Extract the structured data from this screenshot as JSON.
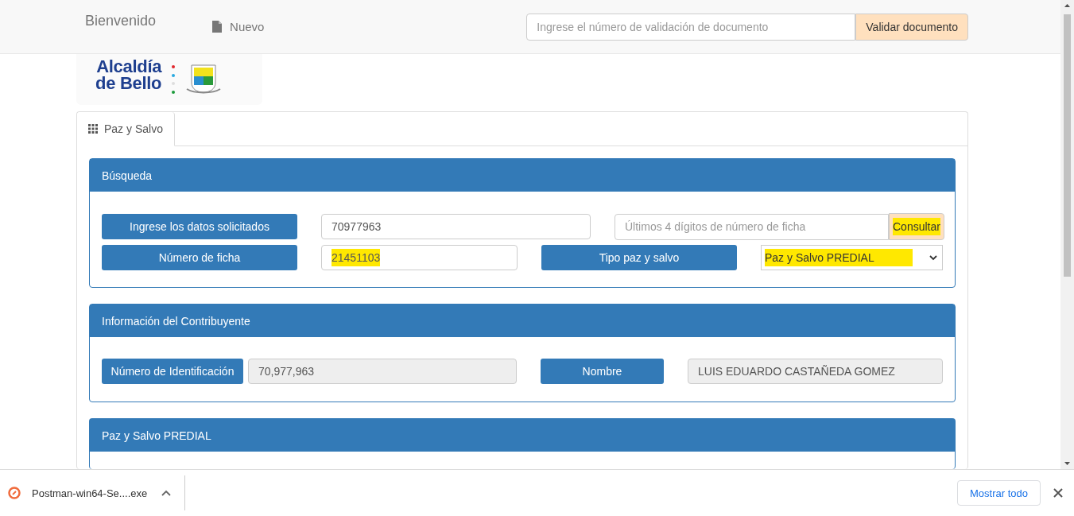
{
  "navbar": {
    "brand": "Bienvenido",
    "new_link": "Nuevo",
    "validation_field": {
      "placeholder": "Ingrese el número de validación de documento"
    },
    "validate_button": "Validar documento"
  },
  "logo": {
    "line_1": "Alcaldía",
    "line_2": "de Bello"
  },
  "tabs": [
    {
      "label": "Paz y Salvo",
      "selected": true
    }
  ],
  "search_panel": {
    "title": "Búsqueda",
    "rows": [
      {
        "kind": "id",
        "label": "Ingrese los datos solicitados",
        "value": "70977963",
        "highlighted": false,
        "digits_field": {
          "placeholder": "Últimos 4 dígitos de número de ficha"
        },
        "button": "Consultar",
        "button_highlighted": true
      },
      {
        "kind": "ficha",
        "label": "Número de ficha",
        "value": "21451103",
        "highlighted": true,
        "type_label": "Tipo paz y salvo",
        "type_value": "Paz y Salvo PREDIAL",
        "type_highlighted": true
      }
    ]
  },
  "taxpayer_panel": {
    "title": "Información del Contribuyente",
    "id_label": "Número de Identificación",
    "id_value": "70,977,963",
    "name_label": "Nombre",
    "name_value": "LUIS EDUARDO CASTAÑEDA GOMEZ"
  },
  "result_panel": {
    "title": "Paz y Salvo PREDIAL"
  },
  "download_bar": {
    "file": "Postman-win64-Se....exe",
    "show_all_button": "Mostrar todo"
  }
}
